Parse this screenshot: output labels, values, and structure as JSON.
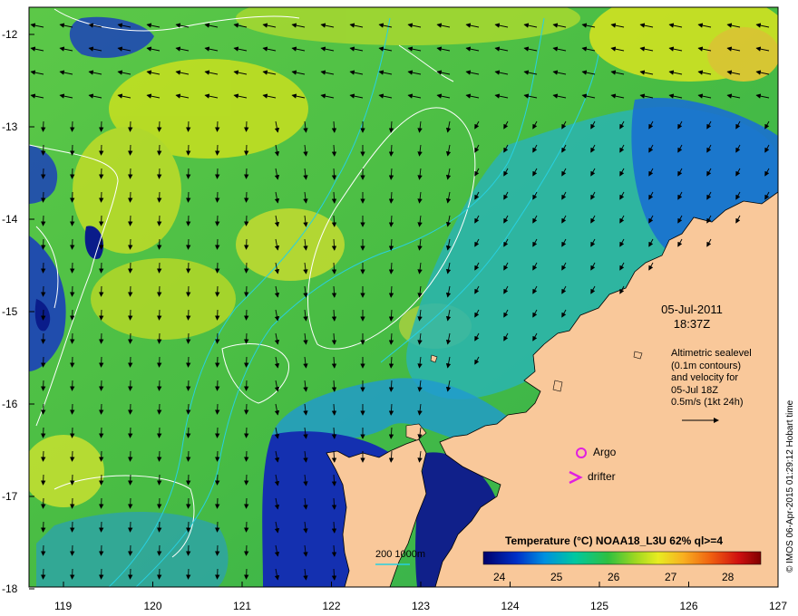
{
  "map": {
    "date_line1": "05-Jul-2011",
    "date_line2": "18:37Z",
    "legend_lines": [
      "Altimetric sealevel",
      "(0.1m contours)",
      "and velocity for",
      "05-Jul 18Z",
      "0.5m/s (1kt 24h)"
    ],
    "argo_label": "Argo",
    "drifter_label": "drifter",
    "colorbar_title": "Temperature (°C) NOAA18_L3U 62% ql>=4",
    "colorbar_ticks": [
      "24",
      "25",
      "26",
      "27",
      "28"
    ],
    "scale_label": "200  1000m",
    "credit": "© IMOS 06-Apr-2015 01:29:12 Hobart time",
    "lat_ticks": [
      "-12",
      "-13",
      "-14",
      "-15",
      "-16",
      "-17",
      "-18"
    ],
    "lon_ticks": [
      "119",
      "120",
      "121",
      "122",
      "123",
      "124",
      "125",
      "126",
      "127"
    ],
    "colors": {
      "land": "#f9c89a",
      "contour": "#ffffff",
      "bathymetry": "#22c8d8",
      "marker": "#e020e0"
    }
  }
}
